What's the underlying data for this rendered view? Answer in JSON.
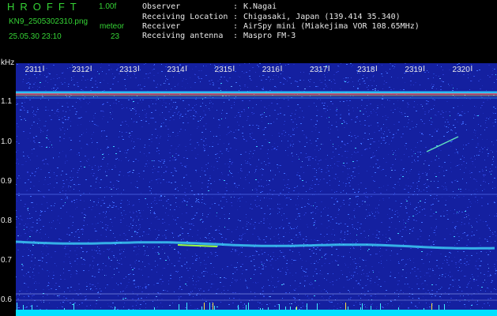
{
  "header": {
    "app_title": "HROFFT",
    "version": "1.00f",
    "filename": "KN9_2505302310.png",
    "datetime": "25.05.30 23:10",
    "meteor_label": "meteor",
    "meteor_count": "23"
  },
  "info": [
    {
      "key": "Observer",
      "value": "K.Nagai"
    },
    {
      "key": "Receiving Location",
      "value": "Chigasaki, Japan (139.414 35.340)"
    },
    {
      "key": "Receiver",
      "value": "AirSpy mini (Miakejima VOR 108.65MHz)"
    },
    {
      "key": "Receiving antenna",
      "value": "Maspro FM-3"
    }
  ],
  "info_separator": ":",
  "axis": {
    "y_unit": "kHz",
    "y_ticks": [
      "1.1",
      "1.0",
      "0.9",
      "0.8",
      "0.7",
      "0.6"
    ],
    "time_ticks": [
      "2311",
      "2312",
      "2313",
      "2314",
      "2315",
      "2316",
      "2317",
      "2318",
      "2319",
      "2320"
    ]
  },
  "colors": {
    "header_green": "#35d335",
    "info_text": "#e8e8e8",
    "spectrogram_bg": "#1420a0",
    "noise_floor": "#00e0ff"
  }
}
